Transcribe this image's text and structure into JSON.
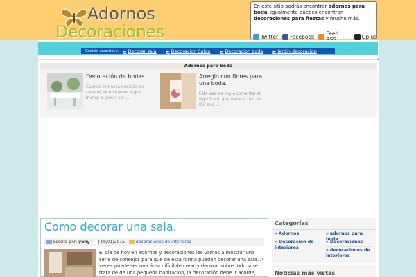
{
  "brand": {
    "line1": "Adornos",
    "line2": "Decoraciones",
    "colors": {
      "brown": "#b58b2a",
      "green": "#9fbf2b",
      "grey": "#5a5a5a"
    }
  },
  "info": {
    "t1": "En este sitio podrás encontrar ",
    "b1": "adornos para boda",
    "t2": ", igualmente puedes encontrar ",
    "b2": "decoraciones para fiestas",
    "t3": " y mucho más."
  },
  "social": [
    {
      "label": "Twitter",
      "icon": "twitter-icon",
      "color": "#3aa0d8"
    },
    {
      "label": "Facebook",
      "icon": "facebook-icon",
      "color": "#3b5998"
    },
    {
      "label": "Feed RSS",
      "icon": "rss-icon",
      "color": "#f28a1c"
    },
    {
      "label": "Gplus",
      "icon": "gplus-icon",
      "color": "#222222"
    }
  ],
  "nav": {
    "first": "Gestión anuncios",
    "items": [
      "Decorar sala",
      "Decoracion Salon",
      "Decoracion boda",
      "Jardin decoracion"
    ]
  },
  "related": {
    "title": "Adornos para boda",
    "cards": [
      {
        "title": "Decoración de bodas",
        "desc": "Cuando tomes la decisión de casarte, te invitamos a que invites a Dios a ser ..."
      },
      {
        "title": "Arreglo con flores para una boda.",
        "desc": "Esta vez les voy a comentar el significado que tiene el tipo de flor que ..."
      }
    ]
  },
  "post": {
    "title": "Como decorar una sala.",
    "author_label": "Escrito por:",
    "author": "yeny",
    "date": "09/01/2015",
    "category": "decoraciones de interiores",
    "text": "El día de hoy en adornos y decoraciones les vamos a mostrar una serie de consejos para que de esta forma puedan decorar una sala.  A veces puede ser una área difícil  de crear y decorar sobre todo si se trata de  de una pequeña habitación, la decoración debe ir  acorde, para que de esta forma"
  },
  "sidebar": {
    "categories_title": "Categorías",
    "categories": [
      "Adornos",
      "adornos para boda",
      "Decoracion de interiores",
      "Decoraciones",
      "decoraciones de interiores"
    ],
    "visits_title": "Noticias más vistas"
  },
  "misc": {
    "marker": "»"
  }
}
